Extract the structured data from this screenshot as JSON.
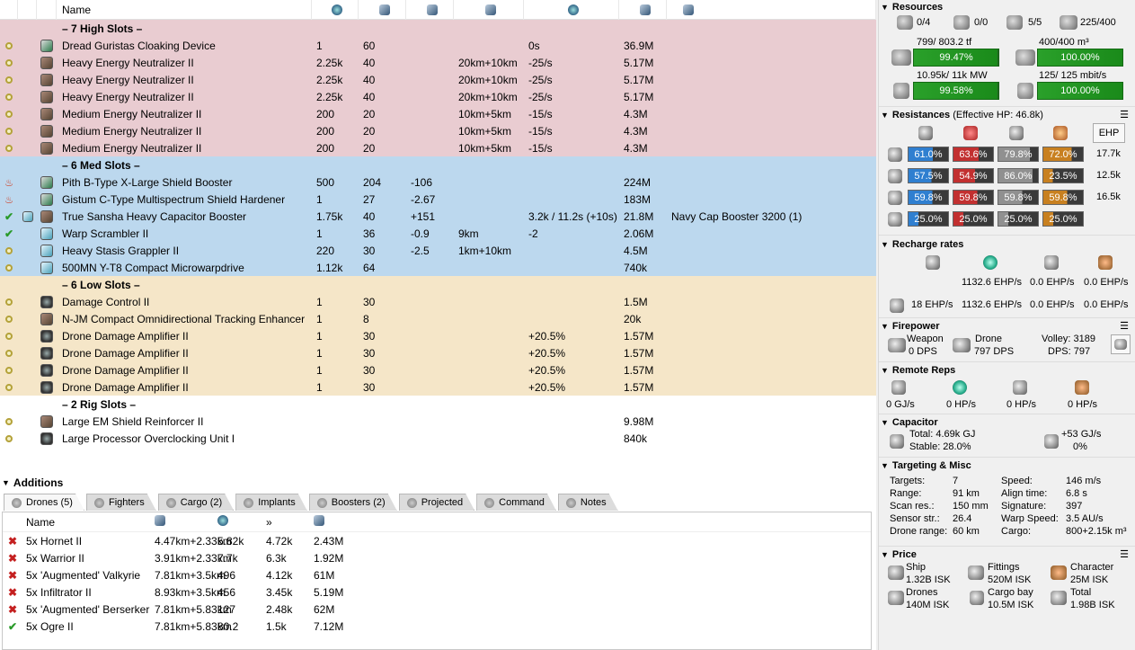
{
  "columns": {
    "name": "Name"
  },
  "racks": {
    "high": {
      "title": "– 7 High Slots –"
    },
    "med": {
      "title": "– 6 Med Slots –"
    },
    "low": {
      "title": "– 6 Low Slots –"
    },
    "rig": {
      "title": "– 2 Rig Slots –"
    }
  },
  "high_modules": [
    {
      "name": "Dread Guristas Cloaking Device",
      "c4": "1",
      "c5": "60",
      "c6": "",
      "c7": "",
      "c8": "0s",
      "c9": "36.9M",
      "c10": ""
    },
    {
      "name": "Heavy Energy Neutralizer II",
      "c4": "2.25k",
      "c5": "40",
      "c6": "",
      "c7": "20km+10km",
      "c8": "-25/s",
      "c9": "5.17M",
      "c10": ""
    },
    {
      "name": "Heavy Energy Neutralizer II",
      "c4": "2.25k",
      "c5": "40",
      "c6": "",
      "c7": "20km+10km",
      "c8": "-25/s",
      "c9": "5.17M",
      "c10": ""
    },
    {
      "name": "Heavy Energy Neutralizer II",
      "c4": "2.25k",
      "c5": "40",
      "c6": "",
      "c7": "20km+10km",
      "c8": "-25/s",
      "c9": "5.17M",
      "c10": ""
    },
    {
      "name": "Medium Energy Neutralizer II",
      "c4": "200",
      "c5": "20",
      "c6": "",
      "c7": "10km+5km",
      "c8": "-15/s",
      "c9": "4.3M",
      "c10": ""
    },
    {
      "name": "Medium Energy Neutralizer II",
      "c4": "200",
      "c5": "20",
      "c6": "",
      "c7": "10km+5km",
      "c8": "-15/s",
      "c9": "4.3M",
      "c10": ""
    },
    {
      "name": "Medium Energy Neutralizer II",
      "c4": "200",
      "c5": "20",
      "c6": "",
      "c7": "10km+5km",
      "c8": "-15/s",
      "c9": "4.3M",
      "c10": ""
    }
  ],
  "med_modules": [
    {
      "name": "Pith B-Type X-Large Shield Booster",
      "c4": "500",
      "c5": "204",
      "c6": "-106",
      "c7": "",
      "c8": "",
      "c9": "224M",
      "c10": ""
    },
    {
      "name": "Gistum C-Type Multispectrum Shield Hardener",
      "c4": "1",
      "c5": "27",
      "c6": "-2.67",
      "c7": "",
      "c8": "",
      "c9": "183M",
      "c10": ""
    },
    {
      "name": "True Sansha Heavy Capacitor Booster",
      "c4": "1.75k",
      "c5": "40",
      "c6": "+151",
      "c7": "",
      "c8": "3.2k / 11.2s (+10s)",
      "c9": "21.8M",
      "c10": "Navy Cap Booster 3200 (1)"
    },
    {
      "name": "Warp Scrambler II",
      "c4": "1",
      "c5": "36",
      "c6": "-0.9",
      "c7": "9km",
      "c8": "-2",
      "c9": "2.06M",
      "c10": ""
    },
    {
      "name": "Heavy Stasis Grappler II",
      "c4": "220",
      "c5": "30",
      "c6": "-2.5",
      "c7": "1km+10km",
      "c8": "",
      "c9": "4.5M",
      "c10": ""
    },
    {
      "name": "500MN Y-T8 Compact Microwarpdrive",
      "c4": "1.12k",
      "c5": "64",
      "c6": "",
      "c7": "",
      "c8": "",
      "c9": "740k",
      "c10": ""
    }
  ],
  "low_modules": [
    {
      "name": "Damage Control II",
      "c4": "1",
      "c5": "30",
      "c6": "",
      "c7": "",
      "c8": "",
      "c9": "1.5M",
      "c10": ""
    },
    {
      "name": "N-JM Compact Omnidirectional Tracking Enhancer",
      "c4": "1",
      "c5": "8",
      "c6": "",
      "c7": "",
      "c8": "",
      "c9": "20k",
      "c10": ""
    },
    {
      "name": "Drone Damage Amplifier II",
      "c4": "1",
      "c5": "30",
      "c6": "",
      "c7": "",
      "c8": "+20.5%",
      "c9": "1.57M",
      "c10": ""
    },
    {
      "name": "Drone Damage Amplifier II",
      "c4": "1",
      "c5": "30",
      "c6": "",
      "c7": "",
      "c8": "+20.5%",
      "c9": "1.57M",
      "c10": ""
    },
    {
      "name": "Drone Damage Amplifier II",
      "c4": "1",
      "c5": "30",
      "c6": "",
      "c7": "",
      "c8": "+20.5%",
      "c9": "1.57M",
      "c10": ""
    },
    {
      "name": "Drone Damage Amplifier II",
      "c4": "1",
      "c5": "30",
      "c6": "",
      "c7": "",
      "c8": "+20.5%",
      "c9": "1.57M",
      "c10": ""
    }
  ],
  "rig_modules": [
    {
      "name": "Large EM Shield Reinforcer II",
      "c9": "9.98M"
    },
    {
      "name": "Large Processor Overclocking Unit I",
      "c9": "840k"
    }
  ],
  "additions": {
    "title": "Additions",
    "tabs": [
      "Drones (5)",
      "Fighters",
      "Cargo (2)",
      "Implants",
      "Boosters (2)",
      "Projected",
      "Command",
      "Notes"
    ],
    "name_header": "Name",
    "drones": [
      {
        "name": "5x Hornet II",
        "range": "4.47km+2.33km",
        "c3": "5.82k",
        "c4": "4.72k",
        "c5": "2.43M",
        "active": false
      },
      {
        "name": "5x Warrior II",
        "range": "3.91km+2.33km",
        "c3": "7.7k",
        "c4": "6.3k",
        "c5": "1.92M",
        "active": false
      },
      {
        "name": "5x 'Augmented' Valkyrie",
        "range": "7.81km+3.5km",
        "c3": "496",
        "c4": "4.12k",
        "c5": "61M",
        "active": false
      },
      {
        "name": "5x Infiltrator II",
        "range": "8.93km+3.5km",
        "c3": "456",
        "c4": "3.45k",
        "c5": "5.19M",
        "active": false
      },
      {
        "name": "5x 'Augmented' Berserker",
        "range": "7.81km+5.83km",
        "c3": "127",
        "c4": "2.48k",
        "c5": "62M",
        "active": false
      },
      {
        "name": "5x Ogre II",
        "range": "7.81km+5.83km",
        "c3": "80.2",
        "c4": "1.5k",
        "c5": "7.12M",
        "active": true
      }
    ]
  },
  "resources": {
    "title": "Resources",
    "turrets": "0/4",
    "launchers": "0/0",
    "drones_active": "5/5",
    "drone_bw_top": "225/400",
    "cpu_label": "799/ 803.2 tf",
    "cpu_pct": "99.47%",
    "cpu_fill": 0.9947,
    "dronebay_label": "400/400 m³",
    "dronebay_pct": "100.00%",
    "dronebay_fill": 1.0,
    "pg_label": "10.95k/ 11k MW",
    "pg_pct": "99.58%",
    "pg_fill": 0.9958,
    "bw_label": "125/ 125 mbit/s",
    "bw_pct": "100.00%",
    "bw_fill": 1.0
  },
  "resistances": {
    "title": "Resistances",
    "ehp_title": "(Effective HP: 46.8k)",
    "ehp_button": "EHP",
    "rows": [
      {
        "em": "61.0%",
        "th": "63.6%",
        "ki": "79.8%",
        "ex": "72.0%",
        "fem": 0.61,
        "fth": 0.636,
        "fki": 0.798,
        "fex": 0.72,
        "hp": "17.7k"
      },
      {
        "em": "57.5%",
        "th": "54.9%",
        "ki": "86.0%",
        "ex": "23.5%",
        "fem": 0.575,
        "fth": 0.549,
        "fki": 0.86,
        "fex": 0.235,
        "hp": "12.5k"
      },
      {
        "em": "59.8%",
        "th": "59.8%",
        "ki": "59.8%",
        "ex": "59.8%",
        "fem": 0.598,
        "fth": 0.598,
        "fki": 0.598,
        "fex": 0.598,
        "hp": "16.5k"
      },
      {
        "em": "25.0%",
        "th": "25.0%",
        "ki": "25.0%",
        "ex": "25.0%",
        "fem": 0.25,
        "fth": 0.25,
        "fki": 0.25,
        "fex": 0.25,
        "hp": ""
      }
    ]
  },
  "recharge": {
    "title": "Recharge rates",
    "row1": [
      "1132.6 EHP/s",
      "0.0 EHP/s",
      "0.0 EHP/s"
    ],
    "row2": [
      "18 EHP/s",
      "1132.6 EHP/s",
      "0.0 EHP/s",
      "0.0 EHP/s"
    ]
  },
  "firepower": {
    "title": "Firepower",
    "weapon_label": "Weapon",
    "weapon_dps": "0 DPS",
    "drone_label": "Drone",
    "drone_dps": "797 DPS",
    "volley": "Volley: 3189",
    "dps": "DPS: 797"
  },
  "remote_reps": {
    "title": "Remote Reps",
    "values": [
      "0 GJ/s",
      "0 HP/s",
      "0 HP/s",
      "0 HP/s"
    ]
  },
  "capacitor": {
    "title": "Capacitor",
    "total": "Total: 4.69k GJ",
    "stable": "Stable: 28.0%",
    "rate": "+53 GJ/s",
    "pct": "0%"
  },
  "targeting": {
    "title": "Targeting & Misc",
    "left": [
      [
        "Targets:",
        "7"
      ],
      [
        "Range:",
        "91 km"
      ],
      [
        "Scan res.:",
        "150 mm"
      ],
      [
        "Sensor str.:",
        "26.4"
      ],
      [
        "Drone range:",
        "60 km"
      ]
    ],
    "right": [
      [
        "Speed:",
        "146 m/s"
      ],
      [
        "Align time:",
        "6.8 s"
      ],
      [
        "Signature:",
        "397"
      ],
      [
        "Warp Speed:",
        "3.5 AU/s"
      ],
      [
        "Cargo:",
        "800+2.15k m³"
      ]
    ]
  },
  "price": {
    "title": "Price",
    "ship_label": "Ship",
    "ship": "1.32B ISK",
    "fittings_label": "Fittings",
    "fittings": "520M ISK",
    "character_label": "Character",
    "character": "25M ISK",
    "drones_label": "Drones",
    "drones": "140M ISK",
    "cargo_label": "Cargo bay",
    "cargo": "10.5M ISK",
    "total_label": "Total",
    "total": "1.98B ISK"
  },
  "colors": {
    "high": "#e9ccd1",
    "med": "#bcd8ee",
    "low": "#f5e6c8",
    "bar_green": "#2a9a2a"
  }
}
